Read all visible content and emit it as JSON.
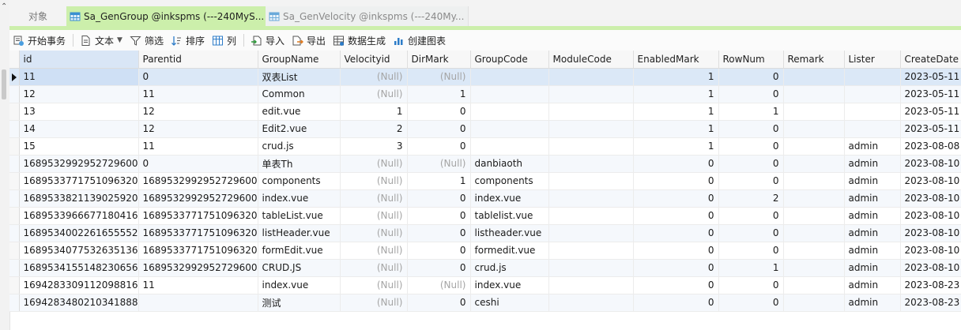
{
  "tabs": {
    "objects_label": "对象",
    "active_label": "Sa_GenGroup @inkspms (---240MyS...",
    "inactive_label": "Sa_GenVelocity @inkspms (---240My..."
  },
  "toolbar": {
    "begin_tx": "开始事务",
    "text": "文本",
    "filter": "筛选",
    "sort": "排序",
    "columns": "列",
    "import": "导入",
    "export": "导出",
    "datagen": "数据生成",
    "chart": "创建图表"
  },
  "table": {
    "columns": [
      "id",
      "Parentid",
      "GroupName",
      "Velocityid",
      "DirMark",
      "GroupCode",
      "ModuleCode",
      "EnabledMark",
      "RowNum",
      "Remark",
      "Lister",
      "CreateDate"
    ],
    "rows": [
      [
        "11",
        "0",
        "双表List",
        "(Null)",
        "(Null)",
        "",
        "",
        "1",
        "0",
        "",
        "",
        "2023-05-11"
      ],
      [
        "12",
        "11",
        "Common",
        "(Null)",
        "1",
        "",
        "",
        "1",
        "0",
        "",
        "",
        "2023-05-11"
      ],
      [
        "13",
        "12",
        "edit.vue",
        "1",
        "0",
        "",
        "",
        "1",
        "1",
        "",
        "",
        "2023-05-11"
      ],
      [
        "14",
        "12",
        "Edit2.vue",
        "2",
        "0",
        "",
        "",
        "1",
        "0",
        "",
        "",
        "2023-05-11"
      ],
      [
        "15",
        "11",
        "crud.js",
        "3",
        "0",
        "",
        "",
        "1",
        "0",
        "",
        "admin",
        "2023-08-08"
      ],
      [
        "1689532992952729600",
        "0",
        "单表Th",
        "(Null)",
        "(Null)",
        "danbiaoth",
        "",
        "0",
        "0",
        "",
        "admin",
        "2023-08-10"
      ],
      [
        "1689533771751096320",
        "1689532992952729600",
        "components",
        "(Null)",
        "1",
        "components",
        "",
        "0",
        "0",
        "",
        "admin",
        "2023-08-10"
      ],
      [
        "1689533821139025920",
        "1689532992952729600",
        "index.vue",
        "(Null)",
        "0",
        "index.vue",
        "",
        "0",
        "2",
        "",
        "admin",
        "2023-08-10"
      ],
      [
        "1689533966677180416",
        "1689533771751096320",
        "tableList.vue",
        "(Null)",
        "0",
        "tablelist.vue",
        "",
        "0",
        "0",
        "",
        "admin",
        "2023-08-10"
      ],
      [
        "1689534002261655552",
        "1689533771751096320",
        "listHeader.vue",
        "(Null)",
        "0",
        "listheader.vue",
        "",
        "0",
        "0",
        "",
        "admin",
        "2023-08-10"
      ],
      [
        "1689534077532635136",
        "1689533771751096320",
        "formEdit.vue",
        "(Null)",
        "0",
        "formedit.vue",
        "",
        "0",
        "0",
        "",
        "admin",
        "2023-08-10"
      ],
      [
        "1689534155148230656",
        "1689532992952729600",
        "CRUD.JS",
        "(Null)",
        "0",
        "crud.js",
        "",
        "0",
        "1",
        "",
        "admin",
        "2023-08-10"
      ],
      [
        "1694283309112098816",
        "11",
        "index.vue",
        "(Null)",
        "(Null)",
        "index.vue",
        "",
        "0",
        "0",
        "",
        "admin",
        "2023-08-23"
      ],
      [
        "1694283480210341888",
        "",
        "测试",
        "(Null)",
        "0",
        "ceshi",
        "",
        "0",
        "0",
        "",
        "admin",
        "2023-08-23"
      ]
    ]
  }
}
